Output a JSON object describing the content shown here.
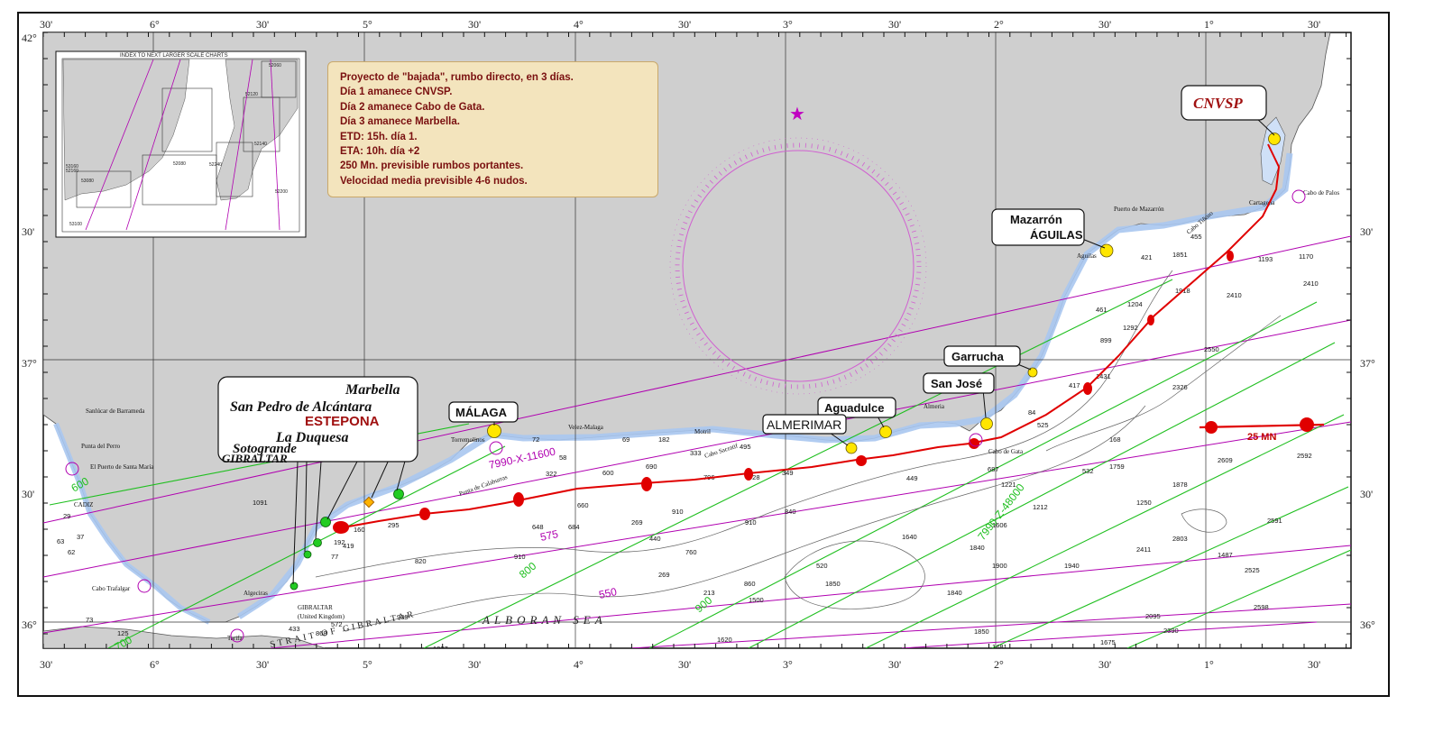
{
  "lon_labels_top": [
    "30'",
    "6°",
    "30'",
    "5°",
    "30'",
    "4°",
    "30'",
    "3°",
    "30'",
    "2°",
    "30'",
    "1°",
    "30'"
  ],
  "lon_labels_bottom": [
    "30'",
    "6°",
    "30'",
    "5°",
    "30'",
    "4°",
    "30'",
    "3°",
    "30'",
    "2°",
    "30'",
    "1°",
    "30'"
  ],
  "lat_labels_left": [
    "42°",
    "30'",
    "37°",
    "30'",
    "36°"
  ],
  "lat_labels_right": [
    "30'",
    "37°",
    "30'",
    "36°"
  ],
  "plan_note": {
    "lines": [
      "Proyecto de \"bajada\", rumbo directo, en 3 días.",
      "Día 1 amanece CNVSP.",
      "Día 2 amanece Cabo de Gata.",
      "Día 3 amanece Marbella.",
      "ETD: 15h. día 1.",
      "ETA: 10h. día +2",
      "250 Mn. previsible rumbos portantes.",
      "Velocidad media previsible 4-6 nudos."
    ]
  },
  "callouts": {
    "cnvsp": "CNVSP",
    "mazarron": "Mazarrón",
    "aguilas": "ÁGUILAS",
    "garrucha": "Garrucha",
    "san_jose": "San José",
    "aguadulce": "Aguadulce",
    "almerimar": "ALMERIMAR",
    "malaga": "MÁLAGA",
    "ports_west": [
      "Marbella",
      "San Pedro de Alcántara",
      "ESTEPONA",
      "La Duquesa",
      "Sotogrande",
      "GIBRALTAR"
    ]
  },
  "scale_label": "25 MN",
  "sea_name": "ALBORAN SEA",
  "strait_name": "STRAIT OF GIBRALTAR",
  "inset": {
    "title": "INDEX TO NEXT LARGER SCALE CHARTS",
    "codes": [
      "52060",
      "52120",
      "52140",
      "52160",
      "52240",
      "52200",
      "53080",
      "53160",
      "53100",
      "52080"
    ]
  },
  "loran_labels": [
    "7990-X-11600",
    "7990-Z-48000",
    "575",
    "550",
    "600",
    "800",
    "900",
    "700"
  ],
  "place_names": [
    "Sanlúcar de Barrameda",
    "Punta del Perro",
    "El Puerto de Santa María",
    "CADIZ",
    "Cabo Trafalgar",
    "Algeciras",
    "GIBRALTAR",
    "(United Kingdom)",
    "Tarifa",
    "Torremolinos",
    "Velez-Malaga",
    "Motril",
    "Almeria",
    "Cabo de Gata",
    "Puerto de Mazarrón",
    "Cartagena",
    "Cabo de Palos",
    "Aguilas",
    "Cabo Tiñoso",
    "Punta de Calaburras",
    "Cabo Sacratif"
  ],
  "colors": {
    "land": "#cfcfcf",
    "sea": "#ffffff",
    "shallow": "#cfe0f7",
    "route": "#e00000",
    "loran_purple": "#b000b0",
    "loran_green": "#1fbf1f",
    "note_bg": "#f3e4bd",
    "note_text": "#7a1010",
    "marker_yellow": "#ffe600",
    "marker_green": "#22cc22"
  },
  "icons": [
    "compass-rose-icon",
    "north-star-icon",
    "day-waypoint-marker-icon",
    "port-marker-icon",
    "buoy-icon"
  ]
}
